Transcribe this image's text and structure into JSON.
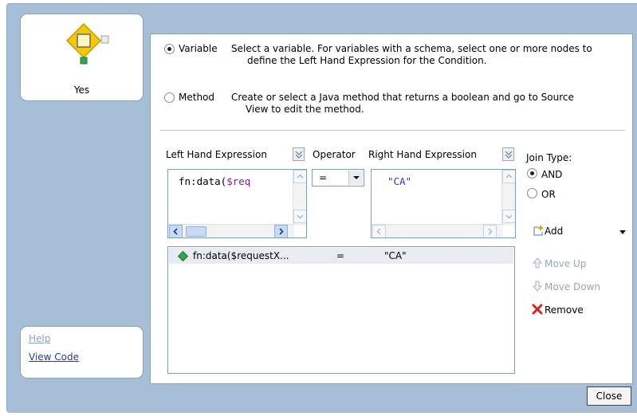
{
  "node": {
    "label": "Yes"
  },
  "links": {
    "help": "Help",
    "view_code": "View Code"
  },
  "options": {
    "variable": {
      "label": "Variable",
      "desc_line1": "Select a variable. For variables with a schema, select one or more nodes to",
      "desc_line2": "define the Left Hand Expression for the Condition.",
      "checked": true
    },
    "method": {
      "label": "Method",
      "desc_line1": "Create or select a Java method that returns a boolean and go to Source",
      "desc_line2": "View to edit the method.",
      "checked": false
    }
  },
  "expression": {
    "lhs_label": "Left Hand Expression",
    "lhs_value_prefix": "fn:data(",
    "lhs_value_var": "$req",
    "operator_label": "Operator",
    "operator_value": "=",
    "rhs_label": "Right Hand Expression",
    "rhs_value": "\"CA\""
  },
  "join": {
    "label": "Join Type:",
    "and": "AND",
    "or": "OR",
    "selected": "AND"
  },
  "actions": {
    "add": "Add",
    "move_up": "Move Up",
    "move_down": "Move Down",
    "remove": "Remove"
  },
  "conditions": [
    {
      "lhs": "fn:data($requestX...",
      "op": "=",
      "rhs": "\"CA\""
    }
  ],
  "footer": {
    "close": "Close"
  },
  "colors": {
    "dialog_bg": "#a7bed7",
    "variable_color": "#7a1fa2",
    "string_color": "#1f3fbf",
    "remove_red": "#d4271c",
    "diamond_green": "#2fa84a",
    "node_yellow": "#f5c800"
  }
}
